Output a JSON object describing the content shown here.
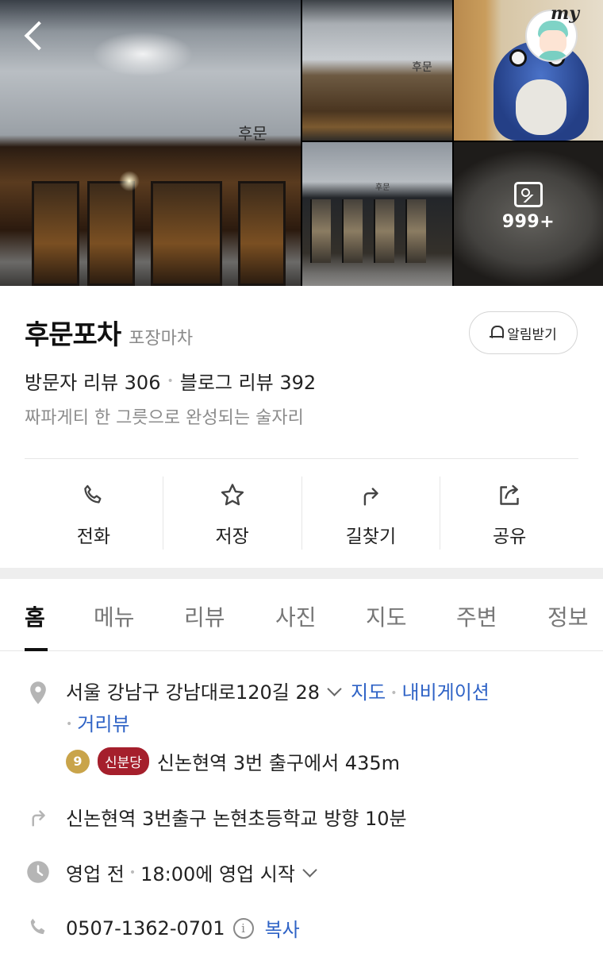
{
  "header": {
    "avatar_tag": "my",
    "photo_count": "999+",
    "photo_signs": [
      "후문",
      "후문",
      "후문"
    ]
  },
  "place": {
    "name": "후문포차",
    "category": "포장마차",
    "notify_label": "알림받기",
    "visitor_reviews": "방문자 리뷰 306",
    "blog_reviews": "블로그 리뷰 392",
    "tagline": "짜파게티 한 그릇으로 완성되는 술자리"
  },
  "actions": [
    {
      "label": "전화",
      "icon": "phone-icon"
    },
    {
      "label": "저장",
      "icon": "star-icon"
    },
    {
      "label": "길찾기",
      "icon": "directions-icon"
    },
    {
      "label": "공유",
      "icon": "share-icon"
    }
  ],
  "tabs": [
    "홈",
    "메뉴",
    "리뷰",
    "사진",
    "지도",
    "주변",
    "정보"
  ],
  "info": {
    "address": "서울 강남구 강남대로120길 28",
    "map_link": "지도",
    "navigation_link": "내비게이션",
    "street_view_link": "거리뷰",
    "subway_line_number": "9",
    "subway_line_name": "신분당",
    "subway_text": "신논현역 3번 출구에서 435m",
    "directions_text": "신논현역 3번출구 논현초등학교 방향 10분",
    "hours_status": "영업 전",
    "hours_text": "18:00에 영업 시작",
    "phone": "0507-1362-0701",
    "copy_label": "복사"
  },
  "colors": {
    "link": "#2f63c6",
    "subway_line_9": "#c9a44a",
    "shinbundang": "#a51f2c"
  }
}
